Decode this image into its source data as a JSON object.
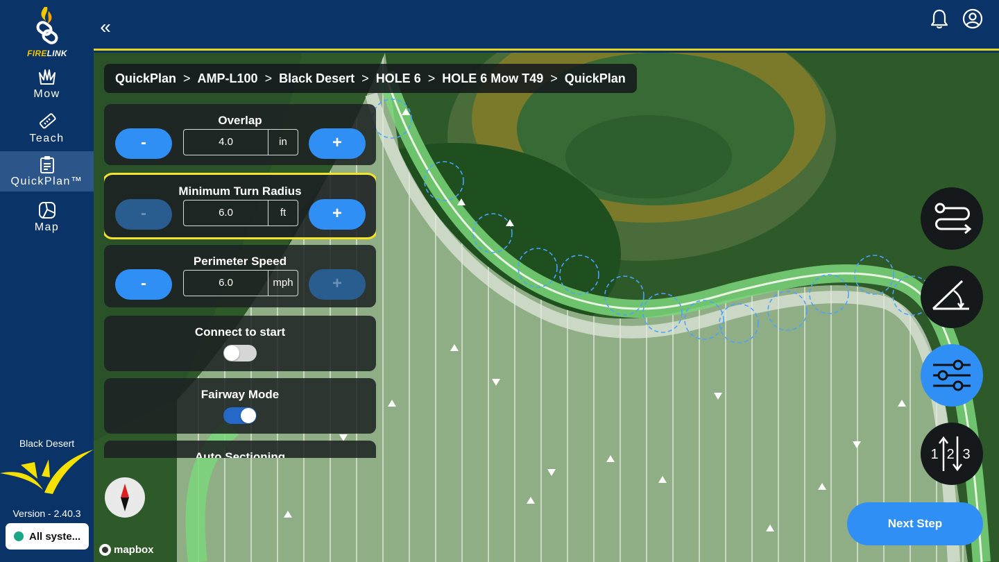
{
  "app": {
    "logo_text_fire": "FIRE",
    "logo_text_link": "LINK"
  },
  "sidebar": {
    "items": [
      {
        "label": "Mow",
        "icon": "grass-icon",
        "active": false
      },
      {
        "label": "Teach",
        "icon": "ruler-icon",
        "active": false
      },
      {
        "label": "QuickPlan™",
        "icon": "clipboard-icon",
        "active": true
      },
      {
        "label": "Map",
        "icon": "map-icon",
        "active": false
      }
    ],
    "site_name": "Black Desert",
    "version": "Version - 2.40.3",
    "status": "All syste..."
  },
  "topbar": {
    "collapse_icon": "«"
  },
  "breadcrumb": [
    "QuickPlan",
    "AMP-L100",
    "Black Desert",
    "HOLE 6",
    "HOLE 6 Mow T49",
    "QuickPlan"
  ],
  "settings": {
    "overlap": {
      "title": "Overlap",
      "value": "4.0",
      "unit": "in",
      "minus": "-",
      "plus": "+"
    },
    "turn_radius": {
      "title": "Minimum Turn Radius",
      "value": "6.0",
      "unit": "ft",
      "minus": "-",
      "plus": "+"
    },
    "perimeter_speed": {
      "title": "Perimeter Speed",
      "value": "6.0",
      "unit": "mph",
      "minus": "-",
      "plus": "+"
    },
    "connect_to_start": {
      "title": "Connect to start",
      "on": false
    },
    "fairway_mode": {
      "title": "Fairway Mode",
      "on": true
    },
    "auto_sectioning": {
      "title": "Auto Sectioning"
    }
  },
  "map": {
    "attribution": "mapbox",
    "sequence_digits": [
      "1",
      "2",
      "3"
    ],
    "next_step": "Next Step"
  },
  "colors": {
    "navy": "#0a3367",
    "accent_blue": "#2f8ff5",
    "highlight_yellow": "#f5e22a",
    "status_green": "#1aa589"
  }
}
